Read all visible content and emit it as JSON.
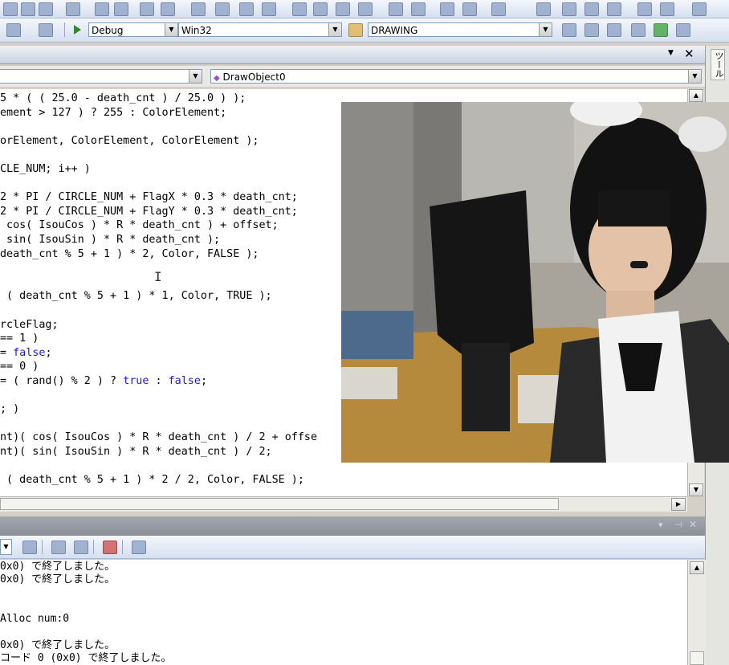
{
  "toolbar": {
    "solution_config": "Debug",
    "solution_platform": "Win32",
    "find_combo": "DRAWING"
  },
  "editor": {
    "member_combo": "DrawObject0",
    "lines": [
      {
        "text": "5 * ( ( 25.0 - death_cnt ) / 25.0 ) );"
      },
      {
        "text": "ement > 127 ) ? 255 : ColorElement;"
      },
      {
        "text": ""
      },
      {
        "text": "orElement, ColorElement, ColorElement );"
      },
      {
        "text": ""
      },
      {
        "text": "CLE_NUM; i++ )"
      },
      {
        "text": ""
      },
      {
        "text": "2 * PI / CIRCLE_NUM + FlagX * 0.3 * death_cnt;"
      },
      {
        "text": "2 * PI / CIRCLE_NUM + FlagY * 0.3 * death_cnt;"
      },
      {
        "text": " cos( IsouCos ) * R * death_cnt ) + offset;"
      },
      {
        "text": " sin( IsouSin ) * R * death_cnt );"
      },
      {
        "text": "death_cnt % 5 + 1 ) * 2, Color, FALSE );"
      },
      {
        "text": ""
      },
      {
        "text": ""
      },
      {
        "text": " ( death_cnt % 5 + 1 ) * 1, Color, TRUE );"
      },
      {
        "text": ""
      },
      {
        "text": "rcleFlag;"
      },
      {
        "text": "== 1 )"
      },
      {
        "pre": "= ",
        "kw": "false",
        "post": ";"
      },
      {
        "text": "== 0 )"
      },
      {
        "pre": "= ( rand() % 2 ) ? ",
        "kw": "true",
        "mid": " : ",
        "kw2": "false",
        "post": ";"
      },
      {
        "text": ""
      },
      {
        "text": "; )"
      },
      {
        "text": ""
      },
      {
        "text": "nt)( cos( IsouCos ) * R * death_cnt ) / 2 + offse"
      },
      {
        "text": "nt)( sin( IsouSin ) * R * death_cnt ) / 2;"
      },
      {
        "text": ""
      },
      {
        "text": " ( death_cnt % 5 + 1 ) * 2 / 2, Color, FALSE );"
      }
    ]
  },
  "right_panel": {
    "label": "ツール"
  },
  "output": {
    "lines": [
      "0x0) で終了しました。",
      "0x0) で終了しました。",
      "",
      "",
      "Alloc num:0",
      "",
      "0x0) で終了しました。",
      "コード 0 (0x0) で終了しました。"
    ]
  }
}
